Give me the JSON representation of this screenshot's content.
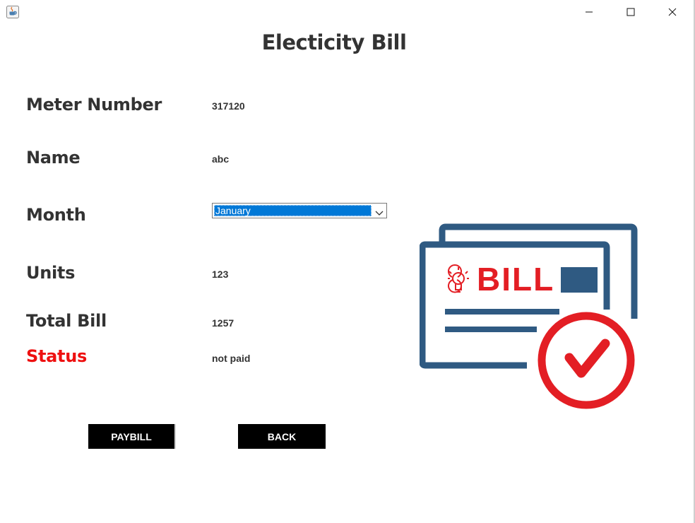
{
  "window": {
    "controls": [
      "minimize-icon",
      "maximize-icon",
      "close-icon"
    ]
  },
  "heading": "Electicity Bill",
  "fields": {
    "meter_number": {
      "label": "Meter Number",
      "value": "317120"
    },
    "name": {
      "label": "Name",
      "value": "abc"
    },
    "month": {
      "label": "Month",
      "selected": "January"
    },
    "units": {
      "label": "Units",
      "value": "123"
    },
    "total_bill": {
      "label": "Total Bill",
      "value": "1257"
    },
    "status": {
      "label": "Status",
      "value": "not paid"
    }
  },
  "buttons": {
    "pay": "PAYBILL",
    "back": "BACK"
  },
  "illustration": {
    "text": "BILL",
    "icon": "bill-paid-icon"
  },
  "colors": {
    "status_label": "#ee1010",
    "selection": "#0078d7",
    "bill_blue": "#2f5a82",
    "bill_red": "#e31e24",
    "button_bg": "#000000"
  }
}
